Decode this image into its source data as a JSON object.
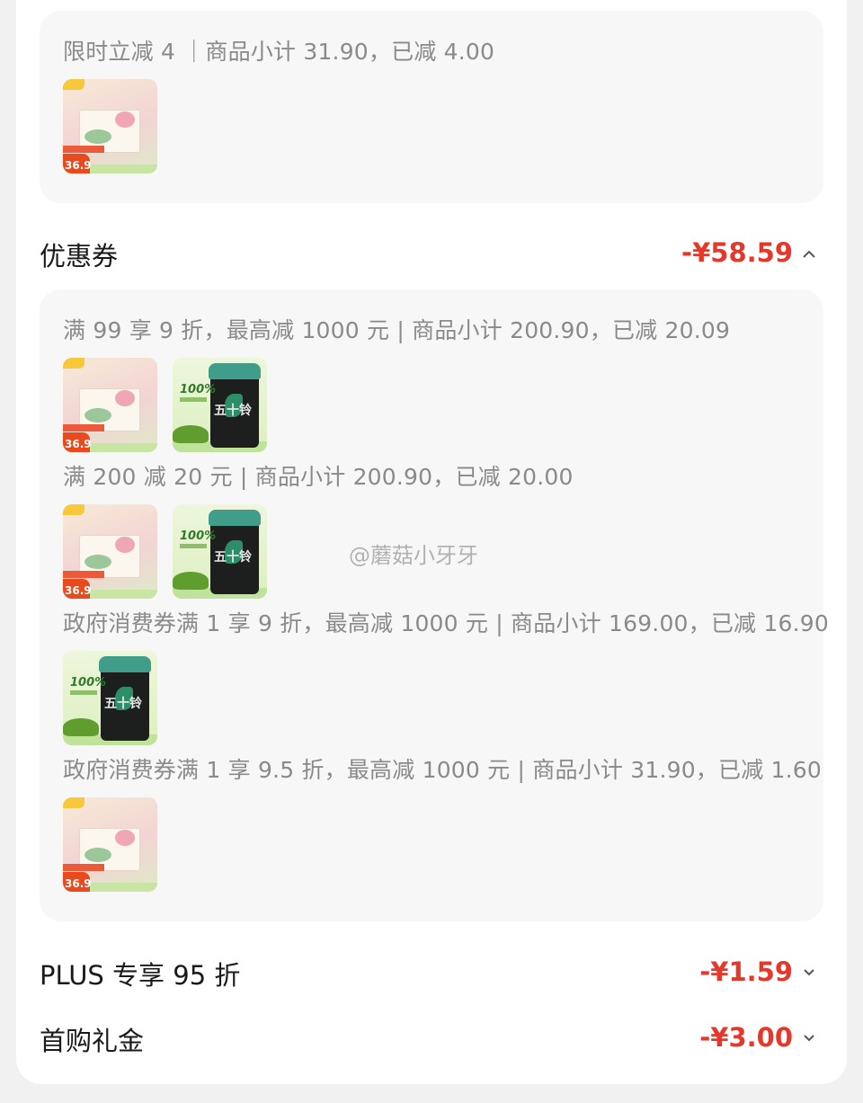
{
  "limited_discount": {
    "rule": "限时立减 4 ｜商品小计 31.90，已减 4.00",
    "items": [
      {
        "name": "pink-gift-box-product",
        "price": "36.9"
      }
    ]
  },
  "coupons": {
    "title": "优惠券",
    "amount": "-¥58.59",
    "expanded_icon": "chevron-up-icon",
    "groups": [
      {
        "rule": "满 99 享 9 折，最高减 1000 元 | 商品小计 200.90，已减 20.09"
      },
      {
        "rule": "满 200 减 20 元 | 商品小计 200.90，已减 20.00"
      },
      {
        "rule": "政府消费券满 1 享 9 折，最高减 1000 元 | 商品小计 169.00，已减 16.90"
      },
      {
        "rule": "政府消费券满 1 享 9.5 折，最高减 1000 元 | 商品小计 31.90，已减 1.60"
      }
    ]
  },
  "product_labels": {
    "pink_price": "36.9",
    "green_pct": "100%",
    "green_can": "五十铃"
  },
  "plus": {
    "title": "PLUS 专享 95 折",
    "amount": "-¥1.59",
    "icon": "chevron-down-icon"
  },
  "first_purchase": {
    "title": "首购礼金",
    "amount": "-¥3.00",
    "icon": "chevron-down-icon"
  },
  "watermark": "@蘑菇小牙牙",
  "colors": {
    "accent_red": "#e5382b",
    "panel": "#f7f7f7"
  }
}
